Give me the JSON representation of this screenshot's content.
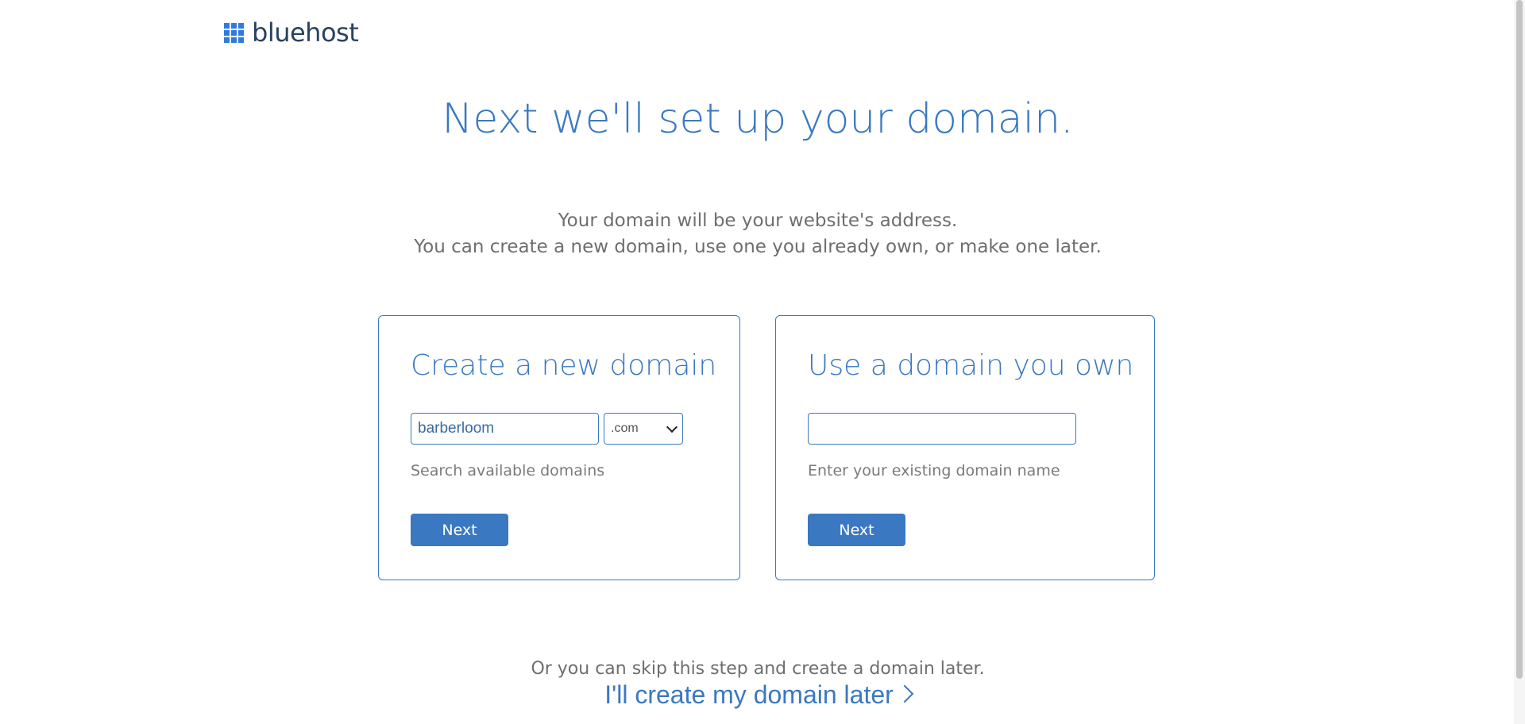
{
  "brand": {
    "logo_text": "bluehost",
    "accent_color": "#3a78c2"
  },
  "headline": "Next we'll set up your domain.",
  "intro": {
    "line1": "Your domain will be your website's address.",
    "line2": "You can create a new domain, use one you already own, or make one later."
  },
  "create_card": {
    "title": "Create a new domain",
    "input_value": "barberloom",
    "tld_selected": ".com",
    "helper": "Search available domains",
    "button_label": "Next"
  },
  "own_card": {
    "title": "Use a domain you own",
    "input_value": "",
    "helper": "Enter your existing domain name",
    "button_label": "Next"
  },
  "skip": {
    "text": "Or you can skip this step and create a domain later.",
    "link_label": "I'll create my domain later"
  },
  "icons": {
    "logo": "grid-logo-icon",
    "select_arrow": "chevron-down-icon",
    "link_arrow": "chevron-right-icon"
  }
}
